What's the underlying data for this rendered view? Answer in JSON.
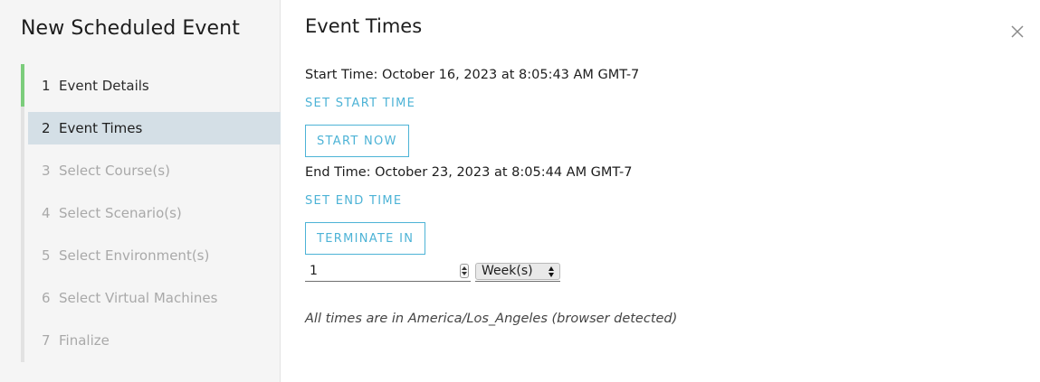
{
  "sidebar": {
    "title": "New Scheduled Event",
    "steps": [
      {
        "num": "1",
        "label": "Event Details",
        "state": "done"
      },
      {
        "num": "2",
        "label": "Event Times",
        "state": "active"
      },
      {
        "num": "3",
        "label": "Select Course(s)",
        "state": "todo"
      },
      {
        "num": "4",
        "label": "Select Scenario(s)",
        "state": "todo"
      },
      {
        "num": "5",
        "label": "Select Environment(s)",
        "state": "todo"
      },
      {
        "num": "6",
        "label": "Select Virtual Machines",
        "state": "todo"
      },
      {
        "num": "7",
        "label": "Finalize",
        "state": "todo"
      }
    ]
  },
  "main": {
    "title": "Event Times",
    "start_time": "Start Time: October 16, 2023 at 8:05:43 AM GMT-7",
    "set_start_label": "SET START TIME",
    "start_now_label": "START NOW",
    "end_time": "End Time: October 23, 2023 at 8:05:44 AM GMT-7",
    "set_end_label": "SET END TIME",
    "terminate_in_label": "TERMINATE IN",
    "duration_value": "1",
    "duration_unit": "Week(s)",
    "timezone_note": "All times are in America/Los_Angeles (browser detected)"
  },
  "icons": {
    "close": "close-icon",
    "stepper": "stepper-arrows-icon",
    "select": "select-arrows-icon"
  },
  "colors": {
    "accent": "#4db3d6",
    "progress": "#7ccd7c",
    "active_step_bg": "#d4dfe6",
    "sidebar_bg": "#f5f5f5"
  }
}
